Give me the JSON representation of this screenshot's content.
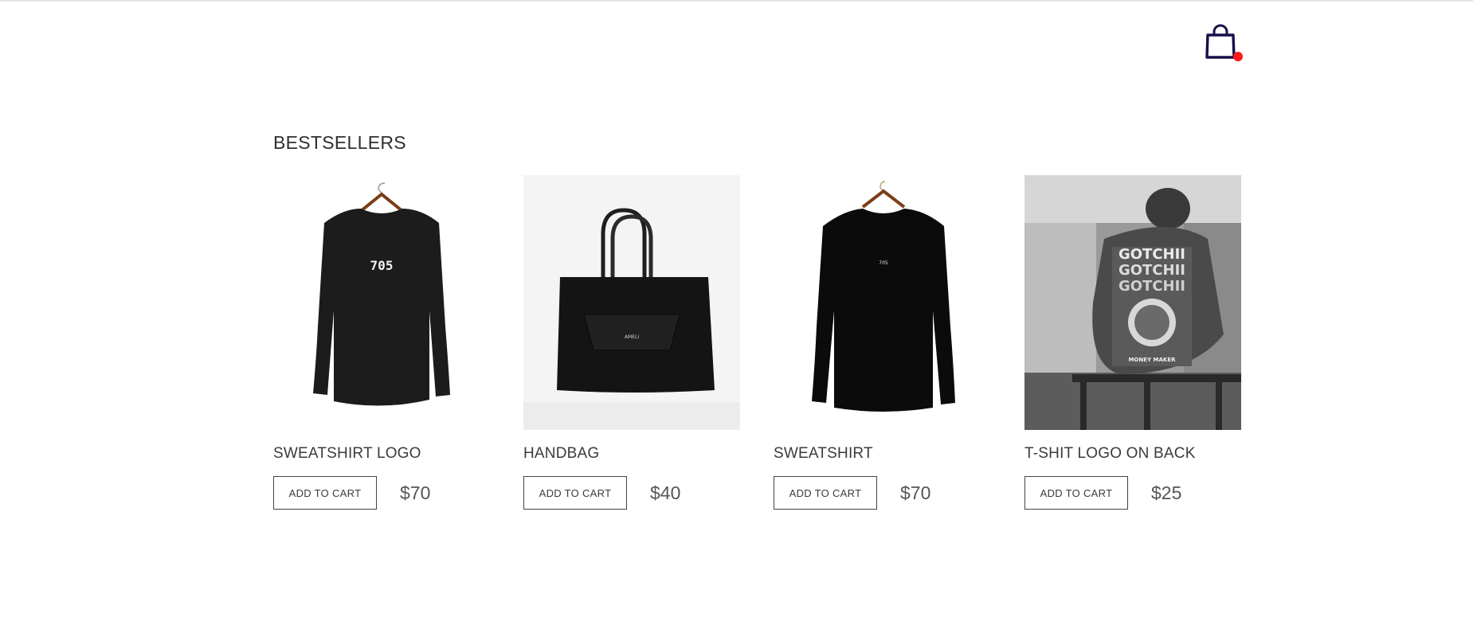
{
  "header": {
    "cart_icon": "shopping-bag-icon",
    "cart_badge_color": "#ff1a1a",
    "cart_icon_color": "#16104a"
  },
  "bestsellers": {
    "title": "BESTSELLERS",
    "products": [
      {
        "name": "SWEATSHIRT LOGO",
        "button_label": "ADD TO CART",
        "price": "$70",
        "image_text": "705",
        "image": "black-sweatshirt-on-hanger"
      },
      {
        "name": "HANDBAG",
        "button_label": "ADD TO CART",
        "price": "$40",
        "image_text": "AMELI",
        "image": "black-leather-handbag"
      },
      {
        "name": "SWEATSHIRT",
        "button_label": "ADD TO CART",
        "price": "$70",
        "image_text": "705",
        "image": "black-sweatshirt-small-logo"
      },
      {
        "name": "T-SHIT LOGO ON BACK",
        "button_label": "ADD TO CART",
        "price": "$25",
        "image_text": "MONEY MAKER",
        "image": "man-wearing-printed-tshirt"
      }
    ]
  }
}
